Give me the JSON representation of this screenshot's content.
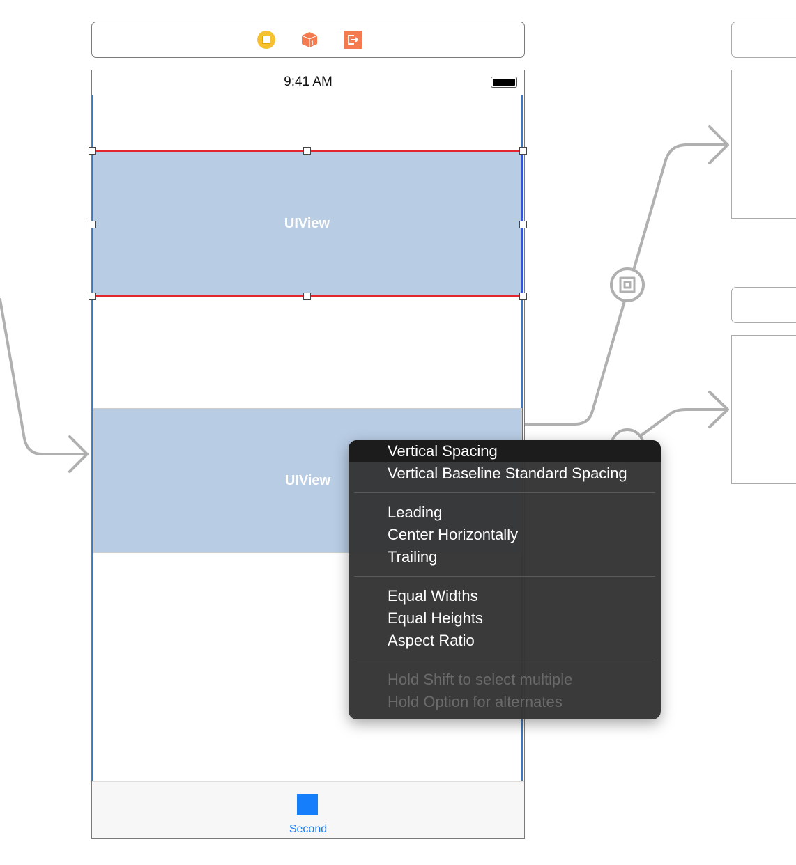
{
  "scene_dock": {
    "icons": [
      "view-controller-icon",
      "first-responder-icon",
      "exit-icon"
    ]
  },
  "status_bar": {
    "time": "9:41 AM"
  },
  "views": [
    {
      "label": "UIView"
    },
    {
      "label": "UIView"
    }
  ],
  "tab_bar": {
    "item_label": "Second",
    "accent": "#147efb"
  },
  "context_menu": {
    "groups": [
      [
        "Vertical Spacing",
        "Vertical Baseline Standard Spacing"
      ],
      [
        "Leading",
        "Center Horizontally",
        "Trailing"
      ],
      [
        "Equal Widths",
        "Equal Heights",
        "Aspect Ratio"
      ]
    ],
    "selected": "Vertical Spacing",
    "hints": [
      "Hold Shift to select multiple",
      "Hold Option for alternates"
    ]
  }
}
